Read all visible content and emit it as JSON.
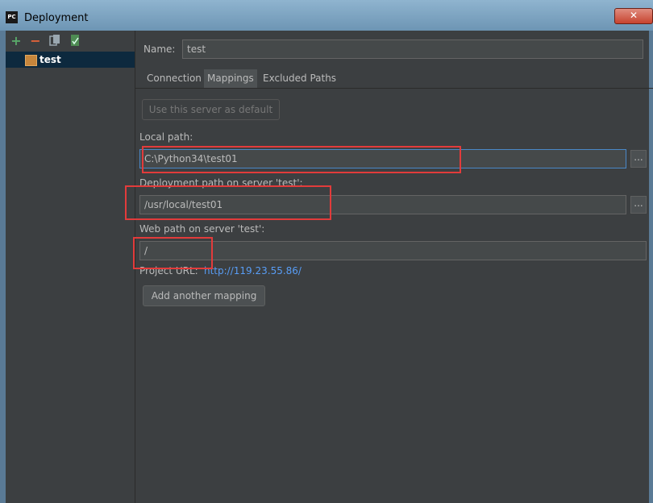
{
  "window": {
    "title": "Deployment",
    "app_icon_text": "PC",
    "close_glyph": "✕"
  },
  "toolbar": {
    "add_glyph": "+",
    "remove_glyph": "−",
    "icons": [
      "add-icon",
      "remove-icon",
      "copy-icon",
      "set-default-icon"
    ]
  },
  "servers": [
    {
      "label": "test",
      "icon": "sftp-server-icon"
    }
  ],
  "name_field": {
    "label": "Name:",
    "value": "test"
  },
  "tabs": [
    "Connection",
    "Mappings",
    "Excluded Paths"
  ],
  "active_tab": "Mappings",
  "use_default_button": "Use this server as default",
  "local_path": {
    "label": "Local path:",
    "value": "C:\\Python34\\test01"
  },
  "deployment_path": {
    "label": "Deployment path on server 'test':",
    "value": "/usr/local/test01"
  },
  "web_path": {
    "label": "Web path on server 'test':",
    "value": "/"
  },
  "project_url": {
    "label": "Project URL:",
    "value": "http://119.23.55.86/"
  },
  "browse_label": "...",
  "add_mapping_button": "Add another mapping",
  "colors": {
    "background": "#3c3f41",
    "field_bg": "#45494a",
    "link": "#589df6",
    "highlight_box": "#e23b3b",
    "selection": "#0d293e"
  }
}
